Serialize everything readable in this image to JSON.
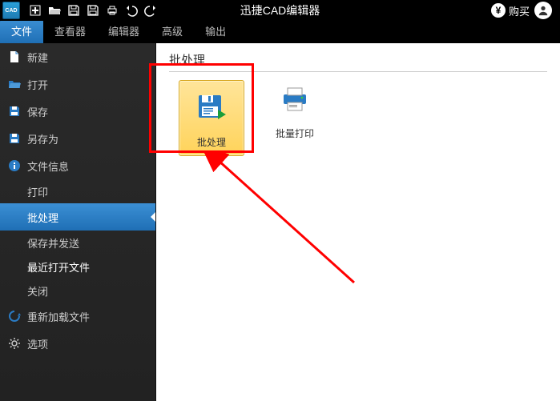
{
  "app_title": "迅捷CAD编辑器",
  "titlebar": {
    "buy_label": "购买"
  },
  "tabs": [
    {
      "label": "文件",
      "active": true
    },
    {
      "label": "查看器"
    },
    {
      "label": "编辑器"
    },
    {
      "label": "高级"
    },
    {
      "label": "输出"
    }
  ],
  "sidebar": [
    {
      "label": "新建",
      "icon": "new"
    },
    {
      "label": "打开",
      "icon": "open"
    },
    {
      "label": "保存",
      "icon": "save"
    },
    {
      "label": "另存为",
      "icon": "saveas"
    },
    {
      "label": "文件信息",
      "icon": "info"
    },
    {
      "label": "打印",
      "icon": "none"
    },
    {
      "label": "批处理",
      "icon": "none",
      "active": true
    },
    {
      "label": "保存并发送",
      "icon": "none"
    },
    {
      "label": "最近打开文件",
      "icon": "none"
    },
    {
      "label": "关闭",
      "icon": "none"
    },
    {
      "label": "重新加载文件",
      "icon": "reload"
    },
    {
      "label": "选项",
      "icon": "gear"
    }
  ],
  "main": {
    "group_title": "批处理",
    "tiles": [
      {
        "label": "批处理",
        "highlight": true,
        "icon": "batch-save"
      },
      {
        "label": "批量打印",
        "icon": "batch-print"
      }
    ]
  }
}
